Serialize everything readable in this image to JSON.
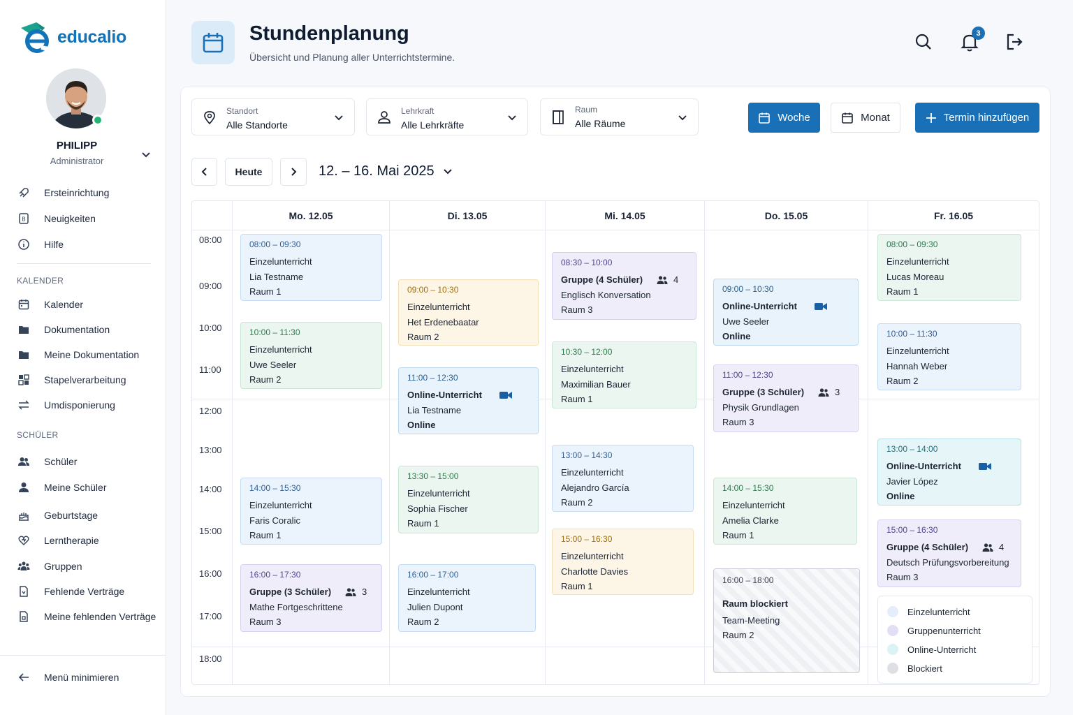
{
  "app": {
    "name": "educalio",
    "brand_color": "#1a70b7"
  },
  "user": {
    "name": "PHILIPP",
    "role": "Administrator"
  },
  "sidebar": {
    "top_items": [
      {
        "label": "Ersteinrichtung",
        "icon": "rocket-icon"
      },
      {
        "label": "Neuigkeiten",
        "icon": "news-icon"
      },
      {
        "label": "Hilfe",
        "icon": "info-icon"
      }
    ],
    "sections": [
      {
        "title": "KALENDER",
        "items": [
          {
            "label": "Kalender",
            "icon": "calendar-icon"
          },
          {
            "label": "Dokumentation",
            "icon": "folder-icon"
          },
          {
            "label": "Meine Dokumentation",
            "icon": "folder-icon"
          },
          {
            "label": "Stapelverarbeitung",
            "icon": "batch-icon"
          },
          {
            "label": "Umdisponierung",
            "icon": "swap-icon"
          }
        ]
      },
      {
        "title": "SCHÜLER",
        "items": [
          {
            "label": "Schüler",
            "icon": "users-icon"
          },
          {
            "label": "Meine Schüler",
            "icon": "user-icon"
          },
          {
            "label": "Geburtstage",
            "icon": "cake-icon"
          },
          {
            "label": "Lerntherapie",
            "icon": "heart-icon"
          },
          {
            "label": "Gruppen",
            "icon": "group-icon"
          },
          {
            "label": "Fehlende Verträge",
            "icon": "document-icon"
          },
          {
            "label": "Meine fehlenden Verträge",
            "icon": "document-icon"
          }
        ]
      }
    ],
    "collapse_label": "Menü minimieren"
  },
  "header": {
    "title": "Stundenplanung",
    "subtitle": "Übersicht und Planung aller Unterrichtstermine.",
    "notification_count": "3"
  },
  "filters": {
    "location": {
      "label": "Standort",
      "value": "Alle Standorte"
    },
    "teacher": {
      "label": "Lehrkraft",
      "value": "Alle Lehrkräfte"
    },
    "room": {
      "label": "Raum",
      "value": "Alle Räume"
    }
  },
  "view_buttons": {
    "week": "Woche",
    "month": "Monat",
    "add": "Termin hinzufügen"
  },
  "navigation": {
    "today": "Heute",
    "range": "12. – 16. Mai 2025"
  },
  "calendar": {
    "days": [
      "Mo. 12.05",
      "Di. 13.05",
      "Mi. 14.05",
      "Do. 15.05",
      "Fr. 16.05"
    ],
    "times": [
      "08:00",
      "09:00",
      "10:00",
      "11:00",
      "12:00",
      "13:00",
      "14:00",
      "15:00",
      "16:00",
      "17:00",
      "18:00"
    ],
    "events": [
      {
        "day": 0,
        "time": "08:00 – 09:30",
        "type": "Einzelunterricht",
        "person": "Lia Testname",
        "room": "Raum 1",
        "kind": "blue"
      },
      {
        "day": 0,
        "time": "10:00 – 11:30",
        "type": "Einzelunterricht",
        "person": "Uwe Seeler",
        "room": "Raum 2",
        "kind": "green"
      },
      {
        "day": 0,
        "time": "14:00 – 15:30",
        "type": "Einzelunterricht",
        "person": "Faris Coralic",
        "room": "Raum 1",
        "kind": "blue"
      },
      {
        "day": 0,
        "time": "16:00 – 17:30",
        "type": "Gruppe (3 Schüler)",
        "count": "3",
        "person": "Mathe Fortgeschrittene",
        "room": "Raum 3",
        "kind": "purple"
      },
      {
        "day": 1,
        "time": "09:00 – 10:30",
        "type": "Einzelunterricht",
        "person": "Het Erdenebaatar",
        "room": "Raum 2",
        "kind": "yellow"
      },
      {
        "day": 1,
        "time": "11:00 – 12:30",
        "type": "Online-Unterricht",
        "person": "Lia Testname",
        "room": "Online",
        "kind": "online"
      },
      {
        "day": 1,
        "time": "13:30 – 15:00",
        "type": "Einzelunterricht",
        "person": "Sophia Fischer",
        "room": "Raum 1",
        "kind": "green"
      },
      {
        "day": 1,
        "time": "16:00 – 17:00",
        "type": "Einzelunterricht",
        "person": "Julien Dupont",
        "room": "Raum 2",
        "kind": "blue"
      },
      {
        "day": 2,
        "time": "08:30 – 10:00",
        "type": "Gruppe (4 Schüler)",
        "count": "4",
        "person": "Englisch Konversation",
        "room": "Raum 3",
        "kind": "purple"
      },
      {
        "day": 2,
        "time": "10:30 – 12:00",
        "type": "Einzelunterricht",
        "person": "Maximilian Bauer",
        "room": "Raum 1",
        "kind": "green"
      },
      {
        "day": 2,
        "time": "13:00 – 14:30",
        "type": "Einzelunterricht",
        "person": "Alejandro García",
        "room": "Raum 2",
        "kind": "blue"
      },
      {
        "day": 2,
        "time": "15:00 – 16:30",
        "type": "Einzelunterricht",
        "person": "Charlotte Davies",
        "room": "Raum 1",
        "kind": "yellow"
      },
      {
        "day": 3,
        "time": "09:00 – 10:30",
        "type": "Online-Unterricht",
        "person": "Uwe Seeler",
        "room": "Online",
        "kind": "online"
      },
      {
        "day": 3,
        "time": "11:00 – 12:30",
        "type": "Gruppe (3 Schüler)",
        "count": "3",
        "person": "Physik Grundlagen",
        "room": "Raum 3",
        "kind": "purple"
      },
      {
        "day": 3,
        "time": "14:00 – 15:30",
        "type": "Einzelunterricht",
        "person": "Amelia Clarke",
        "room": "Raum 1",
        "kind": "green"
      },
      {
        "day": 3,
        "time": "16:00 – 18:00",
        "type": "Raum blockiert",
        "person": "Team-Meeting",
        "room": "Raum 2",
        "kind": "blocked"
      },
      {
        "day": 4,
        "time": "08:00 – 09:30",
        "type": "Einzelunterricht",
        "person": "Lucas Moreau",
        "room": "Raum 1",
        "kind": "green"
      },
      {
        "day": 4,
        "time": "10:00 – 11:30",
        "type": "Einzelunterricht",
        "person": "Hannah Weber",
        "room": "Raum 2",
        "kind": "blue"
      },
      {
        "day": 4,
        "time": "13:00 – 14:00",
        "type": "Online-Unterricht",
        "person": "Javier López",
        "room": "Online",
        "kind": "teal"
      },
      {
        "day": 4,
        "time": "15:00 – 16:30",
        "type": "Gruppe (4 Schüler)",
        "count": "4",
        "person": "Deutsch Prüfungsvorbereitung",
        "room": "Raum 3",
        "kind": "purple"
      }
    ]
  },
  "legend": [
    {
      "label": "Einzelunterricht",
      "color": "#e4eefb"
    },
    {
      "label": "Gruppenunterricht",
      "color": "#e3def6"
    },
    {
      "label": "Online-Unterricht",
      "color": "#dcf2f5"
    },
    {
      "label": "Blockiert",
      "color": "#dcdfe4"
    }
  ]
}
